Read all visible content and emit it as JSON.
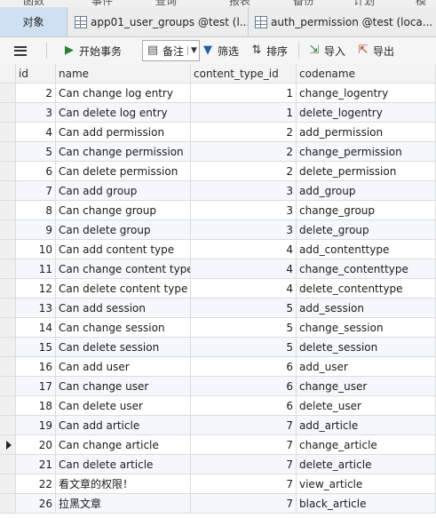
{
  "top_menu": [
    "函数",
    "事件",
    "查询",
    "报表",
    "备份",
    "计划",
    "模型"
  ],
  "tabs": [
    {
      "label": "对象"
    },
    {
      "label": "app01_user_groups @test (l..."
    },
    {
      "label": "auth_permission @test (loca..."
    }
  ],
  "toolbar": {
    "begin_transaction": "开始事务",
    "memo": "备注",
    "filter": "筛选",
    "sort": "排序",
    "import": "导入",
    "export": "导出"
  },
  "columns": [
    "id",
    "name",
    "content_type_id",
    "codename"
  ],
  "rows": [
    {
      "id": "2",
      "name": "Can change log entry",
      "content_type_id": "1",
      "codename": "change_logentry"
    },
    {
      "id": "3",
      "name": "Can delete log entry",
      "content_type_id": "1",
      "codename": "delete_logentry"
    },
    {
      "id": "4",
      "name": "Can add permission",
      "content_type_id": "2",
      "codename": "add_permission"
    },
    {
      "id": "5",
      "name": "Can change permission",
      "content_type_id": "2",
      "codename": "change_permission"
    },
    {
      "id": "6",
      "name": "Can delete permission",
      "content_type_id": "2",
      "codename": "delete_permission"
    },
    {
      "id": "7",
      "name": "Can add group",
      "content_type_id": "3",
      "codename": "add_group"
    },
    {
      "id": "8",
      "name": "Can change group",
      "content_type_id": "3",
      "codename": "change_group"
    },
    {
      "id": "9",
      "name": "Can delete group",
      "content_type_id": "3",
      "codename": "delete_group"
    },
    {
      "id": "10",
      "name": "Can add content type",
      "content_type_id": "4",
      "codename": "add_contenttype"
    },
    {
      "id": "11",
      "name": "Can change content type",
      "content_type_id": "4",
      "codename": "change_contenttype"
    },
    {
      "id": "12",
      "name": "Can delete content type",
      "content_type_id": "4",
      "codename": "delete_contenttype"
    },
    {
      "id": "13",
      "name": "Can add session",
      "content_type_id": "5",
      "codename": "add_session"
    },
    {
      "id": "14",
      "name": "Can change session",
      "content_type_id": "5",
      "codename": "change_session"
    },
    {
      "id": "15",
      "name": "Can delete session",
      "content_type_id": "5",
      "codename": "delete_session"
    },
    {
      "id": "16",
      "name": "Can add user",
      "content_type_id": "6",
      "codename": "add_user"
    },
    {
      "id": "17",
      "name": "Can change user",
      "content_type_id": "6",
      "codename": "change_user"
    },
    {
      "id": "18",
      "name": "Can delete user",
      "content_type_id": "6",
      "codename": "delete_user"
    },
    {
      "id": "19",
      "name": "Can add article",
      "content_type_id": "7",
      "codename": "add_article"
    },
    {
      "id": "20",
      "name": "Can change article",
      "content_type_id": "7",
      "codename": "change_article"
    },
    {
      "id": "21",
      "name": "Can delete article",
      "content_type_id": "7",
      "codename": "delete_article"
    },
    {
      "id": "22",
      "name": "看文章的权限！",
      "content_type_id": "7",
      "codename": "view_article"
    },
    {
      "id": "26",
      "name": "拉黑文章",
      "content_type_id": "7",
      "codename": "black_article"
    }
  ],
  "current_row_id": "20",
  "colors": {
    "active_tab": "#cfe0f3",
    "alt_row": "#f4f7fb",
    "header": "#f3f3f3"
  },
  "icons": [
    "table-icon",
    "menu-icon",
    "begin-transaction-icon",
    "memo-icon",
    "filter-icon",
    "sort-icon",
    "import-icon",
    "export-icon",
    "current-row-arrow-icon"
  ]
}
